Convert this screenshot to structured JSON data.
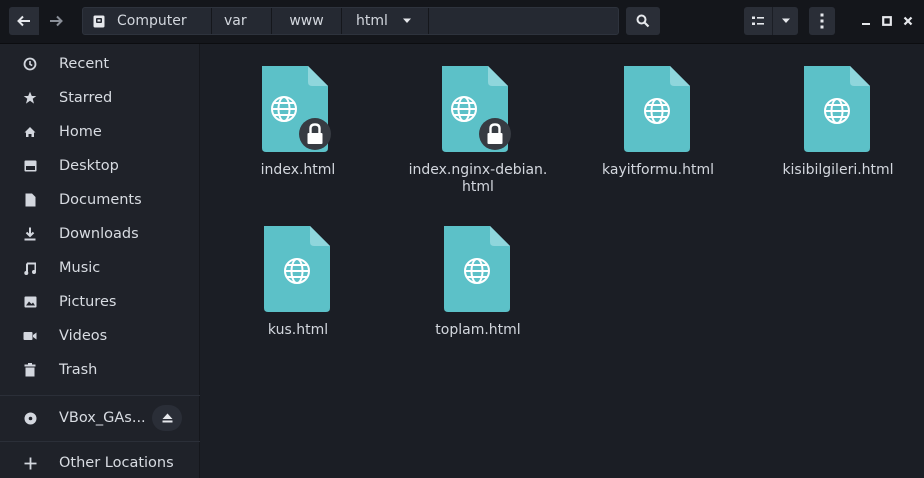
{
  "header": {
    "path": [
      "Computer",
      "var",
      "www",
      "html"
    ],
    "icons": {
      "back": "arrow-left-icon",
      "forward": "arrow-right-icon",
      "drive": "drive-icon",
      "search": "search-icon",
      "view": "list-view-icon",
      "menu": "kebab-menu-icon"
    }
  },
  "sidebar": {
    "items": [
      {
        "label": "Recent",
        "icon": "clock-icon"
      },
      {
        "label": "Starred",
        "icon": "star-icon"
      },
      {
        "label": "Home",
        "icon": "home-icon"
      },
      {
        "label": "Desktop",
        "icon": "desktop-icon"
      },
      {
        "label": "Documents",
        "icon": "document-icon"
      },
      {
        "label": "Downloads",
        "icon": "download-icon"
      },
      {
        "label": "Music",
        "icon": "music-icon"
      },
      {
        "label": "Pictures",
        "icon": "picture-icon"
      },
      {
        "label": "Videos",
        "icon": "video-icon"
      },
      {
        "label": "Trash",
        "icon": "trash-icon"
      }
    ],
    "device": {
      "label": "VBox_GAs...",
      "icon": "disc-icon"
    },
    "other": {
      "label": "Other Locations",
      "icon": "plus-icon"
    }
  },
  "files": [
    {
      "name": "index.html",
      "locked": true
    },
    {
      "name": "index.nginx-debian.\nhtml",
      "locked": true
    },
    {
      "name": "kayitformu.html",
      "locked": false
    },
    {
      "name": "kisibilgileri.html",
      "locked": false
    },
    {
      "name": "kus.html",
      "locked": false
    },
    {
      "name": "toplam.html",
      "locked": false
    }
  ],
  "colors": {
    "file_icon": "#5cc1c8",
    "file_fold": "#8fd6dc",
    "background": "#1b1e25",
    "sidebar": "#1f2229",
    "header": "#14161b"
  }
}
